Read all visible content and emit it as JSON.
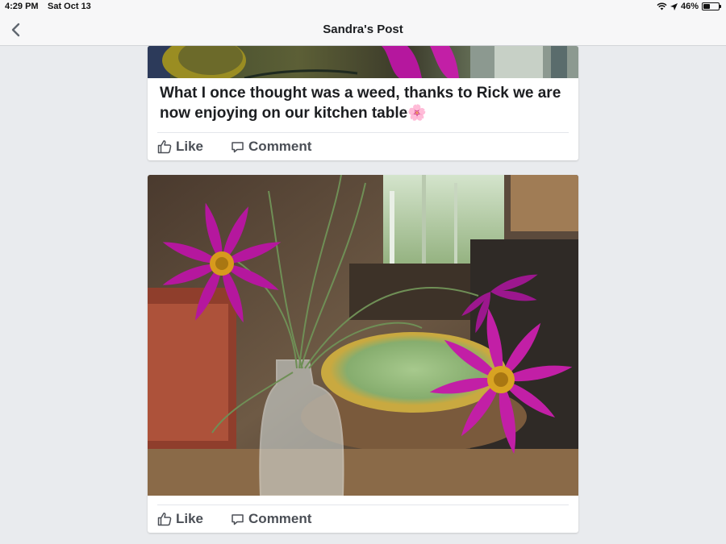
{
  "status_bar": {
    "time": "4:29 PM",
    "date": "Sat Oct 13",
    "battery": "46%",
    "battery_level": 0.46
  },
  "nav": {
    "title": "Sandra's Post",
    "back_icon": "chevron-left-icon"
  },
  "posts": [
    {
      "text": "What I once thought was a weed, thanks to Rick we are now enjoying on our kitchen table🌸",
      "like_label": "Like",
      "comment_label": "Comment"
    },
    {
      "photo": "purple-cosmos-flowers-in-glass-vase",
      "like_label": "Like",
      "comment_label": "Comment"
    }
  ],
  "colors": {
    "background": "#e9ebee",
    "card": "#ffffff",
    "action_text": "#4b4f56",
    "flower": "#b5179e"
  }
}
